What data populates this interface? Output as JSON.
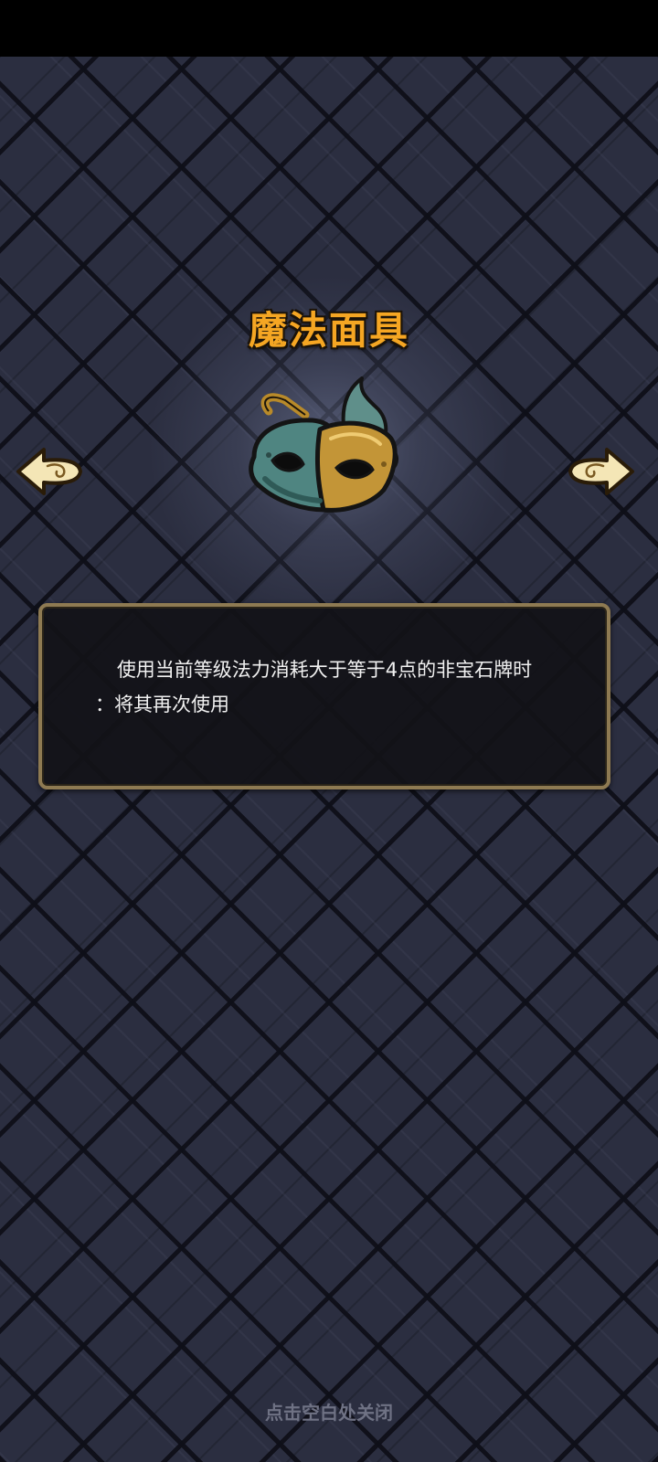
{
  "item": {
    "name": "魔法面具",
    "image": "magic-mask",
    "description_line1": "使用当前等级法力消耗大于等于4点的非宝石牌时",
    "description_line2": "：将其再次使用"
  },
  "navigation": {
    "prev_icon": "left-arrow-icon",
    "next_icon": "right-arrow-icon"
  },
  "footer": {
    "close_hint": "点击空白处关闭"
  },
  "colors": {
    "title": "#f5a623",
    "background": "#2b2e40",
    "panel_border": "#8e7a52",
    "hint": "#6f7284"
  }
}
